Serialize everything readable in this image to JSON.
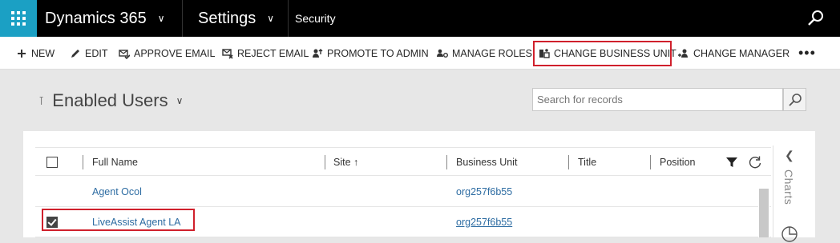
{
  "topnav": {
    "app_title": "Dynamics 365",
    "area_title": "Settings",
    "breadcrumb": "Security"
  },
  "commands": [
    {
      "label": "NEW",
      "icon": "plus-icon"
    },
    {
      "label": "EDIT",
      "icon": "pencil-icon"
    },
    {
      "label": "APPROVE EMAIL",
      "icon": "approve-email-icon"
    },
    {
      "label": "REJECT EMAIL",
      "icon": "reject-email-icon"
    },
    {
      "label": "PROMOTE TO ADMIN",
      "icon": "promote-icon"
    },
    {
      "label": "MANAGE ROLES",
      "icon": "manage-roles-icon"
    },
    {
      "label": "CHANGE BUSINESS UNIT",
      "icon": "change-business-unit-icon"
    },
    {
      "label": "CHANGE MANAGER",
      "icon": "change-manager-icon"
    }
  ],
  "more_label": "•••",
  "view": {
    "title": "Enabled Users",
    "search_placeholder": "Search for records"
  },
  "grid": {
    "columns": [
      "Full Name",
      "Site ↑",
      "Business Unit",
      "Title",
      "Position"
    ],
    "rows": [
      {
        "full_name": "Agent Ocol",
        "business_unit": "org257f6b55",
        "checked": false
      },
      {
        "full_name": "LiveAssist Agent LA",
        "business_unit": "org257f6b55",
        "checked": true
      }
    ]
  },
  "charts_rail": {
    "label": "Charts"
  },
  "colors": {
    "nav_bg": "#000000",
    "waffle_bg": "#1ba0c4",
    "highlight": "#d0202c",
    "link": "#2d6ca2"
  }
}
